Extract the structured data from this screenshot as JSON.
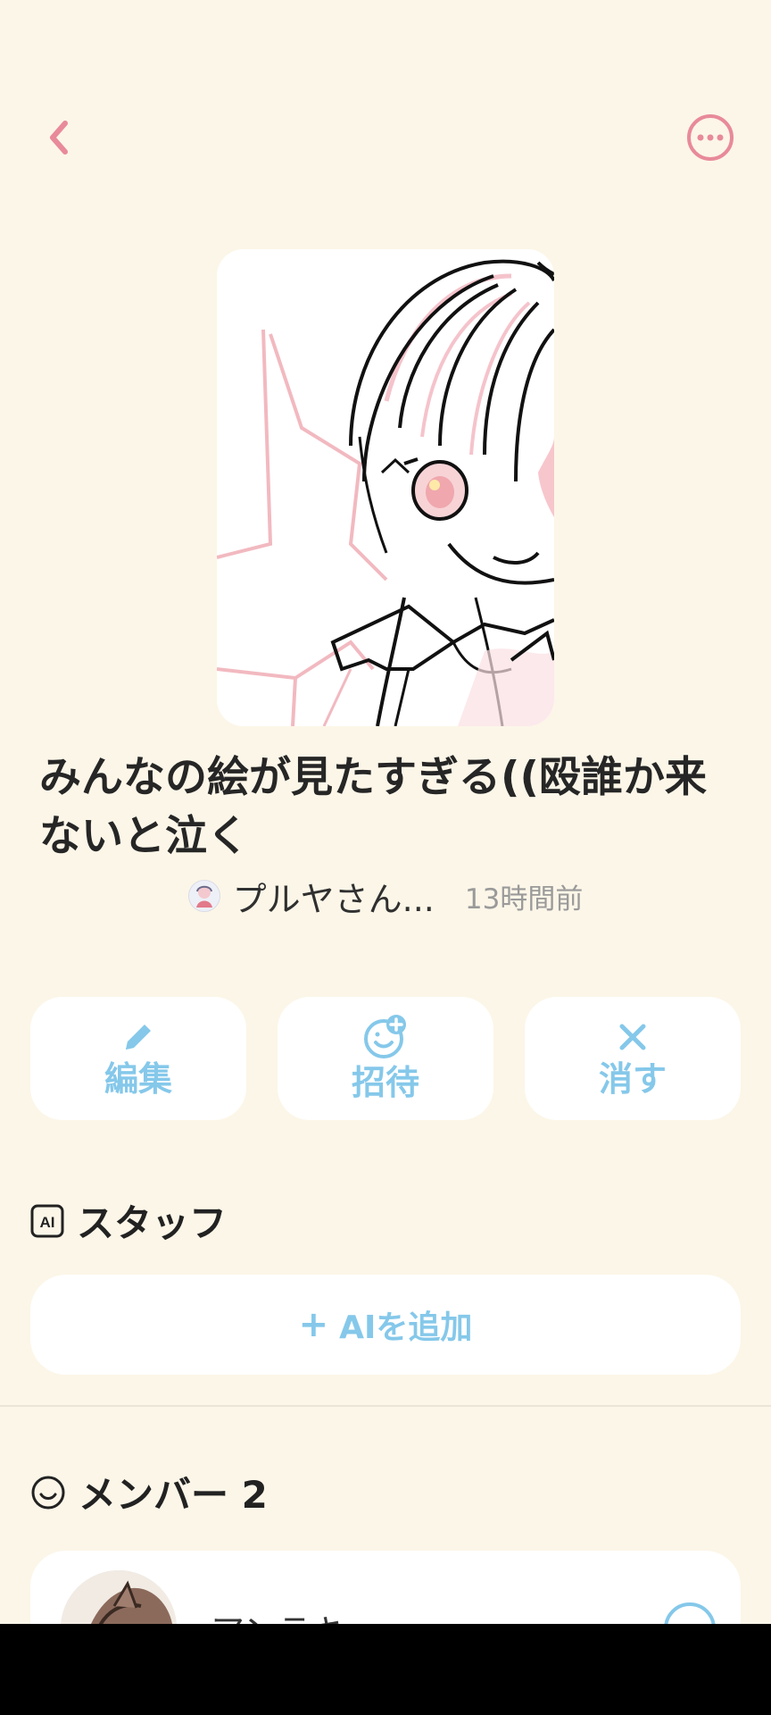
{
  "header": {
    "back_icon": "chevron-left-icon",
    "more_icon": "more-horizontal-circle-icon",
    "accent": "#e88a9a"
  },
  "post": {
    "title": "みんなの絵が見たすぎる((殴誰か来ないと泣く",
    "owner_name": "プルヤさん...",
    "timestamp": "13時間前"
  },
  "actions": [
    {
      "label": "編集",
      "icon": "pencil-icon"
    },
    {
      "label": "招待",
      "icon": "smile-plus-icon"
    },
    {
      "label": "消す",
      "icon": "close-icon"
    }
  ],
  "action_color": "#85c8ea",
  "staff_section": {
    "icon": "ai-badge-icon",
    "title": "スタッフ",
    "add_button_label": "AIを追加",
    "add_icon": "plus-icon"
  },
  "members_section": {
    "icon": "smile-icon",
    "title": "メンバー 2",
    "members": [
      {
        "name": "アンラキ"
      }
    ]
  }
}
